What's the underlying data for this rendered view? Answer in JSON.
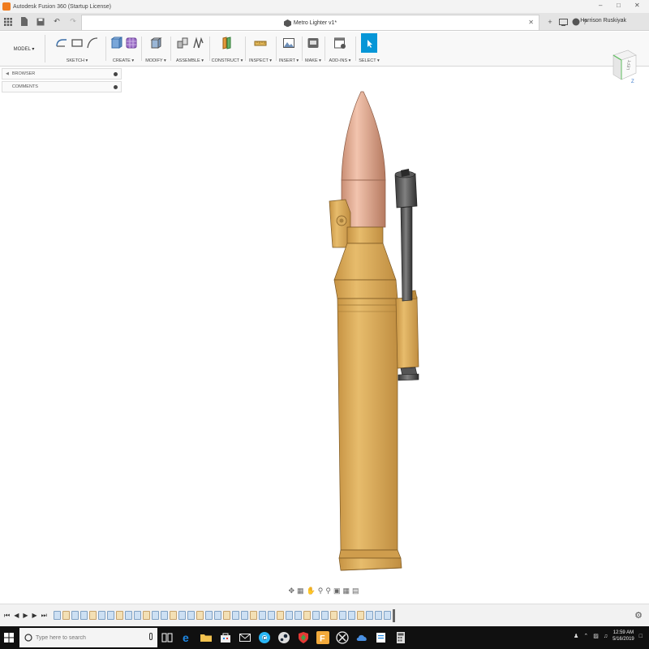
{
  "window": {
    "title": "Autodesk Fusion 360 (Startup License)"
  },
  "tab": {
    "document_title": "Metro Lighter v1*"
  },
  "user": {
    "name": "Harrison Ruskiyak"
  },
  "ribbon": {
    "workspace": "MODEL ▾",
    "groups": [
      {
        "label": "SKETCH ▾"
      },
      {
        "label": "CREATE ▾"
      },
      {
        "label": "MODIFY ▾"
      },
      {
        "label": "ASSEMBLE ▾"
      },
      {
        "label": "CONSTRUCT ▾"
      },
      {
        "label": "INSPECT ▾"
      },
      {
        "label": "INSERT ▾"
      },
      {
        "label": "MAKE ▾"
      },
      {
        "label": "ADD-INS ▾"
      },
      {
        "label": "SELECT ▾"
      }
    ]
  },
  "viewcube": {
    "face": "LEFT",
    "axis": "Z"
  },
  "browser": {
    "label": "BROWSER"
  },
  "comments": {
    "label": "COMMENTS"
  },
  "taskbar": {
    "search_placeholder": "Type here to search",
    "time": "12:59 AM",
    "date": "5/16/2019"
  },
  "colors": {
    "accent": "#0696d7",
    "brass": "#d9a957",
    "copper": "#d8a38a",
    "taskbar": "#101010"
  },
  "icons": [
    "grid-icon",
    "file-icon",
    "save-icon",
    "undo-icon",
    "redo-icon",
    "add-tab-icon",
    "help-icon",
    "orbit-icon",
    "pan-icon",
    "zoom-icon",
    "display-icon",
    "grid-settings-icon",
    "viewports-icon",
    "windows-icon",
    "task-view-icon",
    "edge-icon",
    "folder-icon",
    "store-icon",
    "mail-icon",
    "chrome-icon",
    "steam-icon",
    "fusion-icon",
    "xbox-icon",
    "calculator-icon"
  ]
}
